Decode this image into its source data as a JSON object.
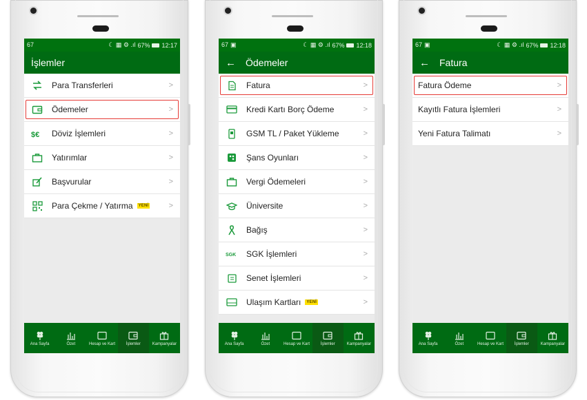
{
  "phones": [
    {
      "status": {
        "left": "67",
        "right_icons": "☾ ▦ ⚙ .ıl",
        "battery": "67%",
        "time": "12:17"
      },
      "header": {
        "title": "İşlemler",
        "back": false
      },
      "items": [
        {
          "label": "Para Transferleri",
          "icon": "transfer-icon",
          "badge": ""
        },
        {
          "label": "Ödemeler",
          "icon": "wallet-icon",
          "badge": ""
        },
        {
          "label": "Döviz İşlemleri",
          "icon": "currency-icon",
          "badge": ""
        },
        {
          "label": "Yatırımlar",
          "icon": "briefcase-icon",
          "badge": ""
        },
        {
          "label": "Başvurular",
          "icon": "pen-icon",
          "badge": ""
        },
        {
          "label": "Para Çekme / Yatırma",
          "icon": "qr-icon",
          "badge": "YENİ"
        }
      ]
    },
    {
      "status": {
        "left": "67",
        "right_icons": "☾ ▦ ⚙ .ıl",
        "battery": "67%",
        "time": "12:18"
      },
      "header": {
        "title": "Ödemeler",
        "back": true
      },
      "items": [
        {
          "label": "Fatura",
          "icon": "document-icon",
          "badge": ""
        },
        {
          "label": "Kredi Kartı Borç Ödeme",
          "icon": "credit-card-icon",
          "badge": ""
        },
        {
          "label": "GSM TL / Paket Yükleme",
          "icon": "phone-icon",
          "badge": ""
        },
        {
          "label": "Şans Oyunları",
          "icon": "lottery-icon",
          "badge": ""
        },
        {
          "label": "Vergi Ödemeleri",
          "icon": "briefcase-icon",
          "badge": ""
        },
        {
          "label": "Üniversite",
          "icon": "graduation-cap-icon",
          "badge": ""
        },
        {
          "label": "Bağış",
          "icon": "ribbon-icon",
          "badge": ""
        },
        {
          "label": "SGK İşlemleri",
          "icon": "sgk-icon",
          "badge": ""
        },
        {
          "label": "Senet İşlemleri",
          "icon": "note-icon",
          "badge": ""
        },
        {
          "label": "Ulaşım Kartları",
          "icon": "card-icon",
          "badge": "YENİ"
        }
      ]
    },
    {
      "status": {
        "left": "67",
        "right_icons": "☾ ▦ ⚙ .ıl",
        "battery": "67%",
        "time": "12:18"
      },
      "header": {
        "title": "Fatura",
        "back": true
      },
      "items": [
        {
          "label": "Fatura Ödeme",
          "icon": "",
          "badge": ""
        },
        {
          "label": "Kayıtlı Fatura İşlemleri",
          "icon": "",
          "badge": ""
        },
        {
          "label": "Yeni Fatura Talimatı",
          "icon": "",
          "badge": ""
        }
      ]
    }
  ],
  "tabbar": {
    "tabs": [
      {
        "label": "Ana Sayfa",
        "icon": "home-clover-icon"
      },
      {
        "label": "Özet",
        "icon": "bar-chart-icon"
      },
      {
        "label": "Hesap ve Kart",
        "icon": "card-outline-icon"
      },
      {
        "label": "İşlemler",
        "icon": "wallet-icon"
      },
      {
        "label": "Kampanyalar",
        "icon": "gift-icon"
      }
    ]
  },
  "colors": {
    "header": "#006b13",
    "status": "#00720f",
    "highlight": "#e53935",
    "badge": "#ffe000",
    "icon": "#1a9a3a"
  }
}
